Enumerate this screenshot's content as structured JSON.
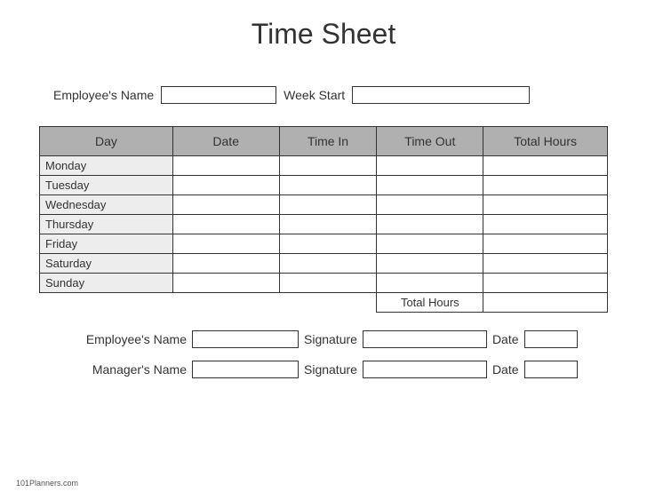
{
  "title": "Time Sheet",
  "top": {
    "employee_label": "Employee's Name",
    "week_label": "Week Start"
  },
  "table": {
    "headers": {
      "day": "Day",
      "date": "Date",
      "time_in": "Time In",
      "time_out": "Time Out",
      "total_hours": "Total Hours"
    },
    "days": {
      "mon": "Monday",
      "tue": "Tuesday",
      "wed": "Wednesday",
      "thu": "Thursday",
      "fri": "Friday",
      "sat": "Saturday",
      "sun": "Sunday"
    },
    "total_label": "Total Hours"
  },
  "sig": {
    "emp_name": "Employee's Name",
    "mgr_name": "Manager's Name",
    "signature": "Signature",
    "date": "Date"
  },
  "footer": "101Planners.com"
}
